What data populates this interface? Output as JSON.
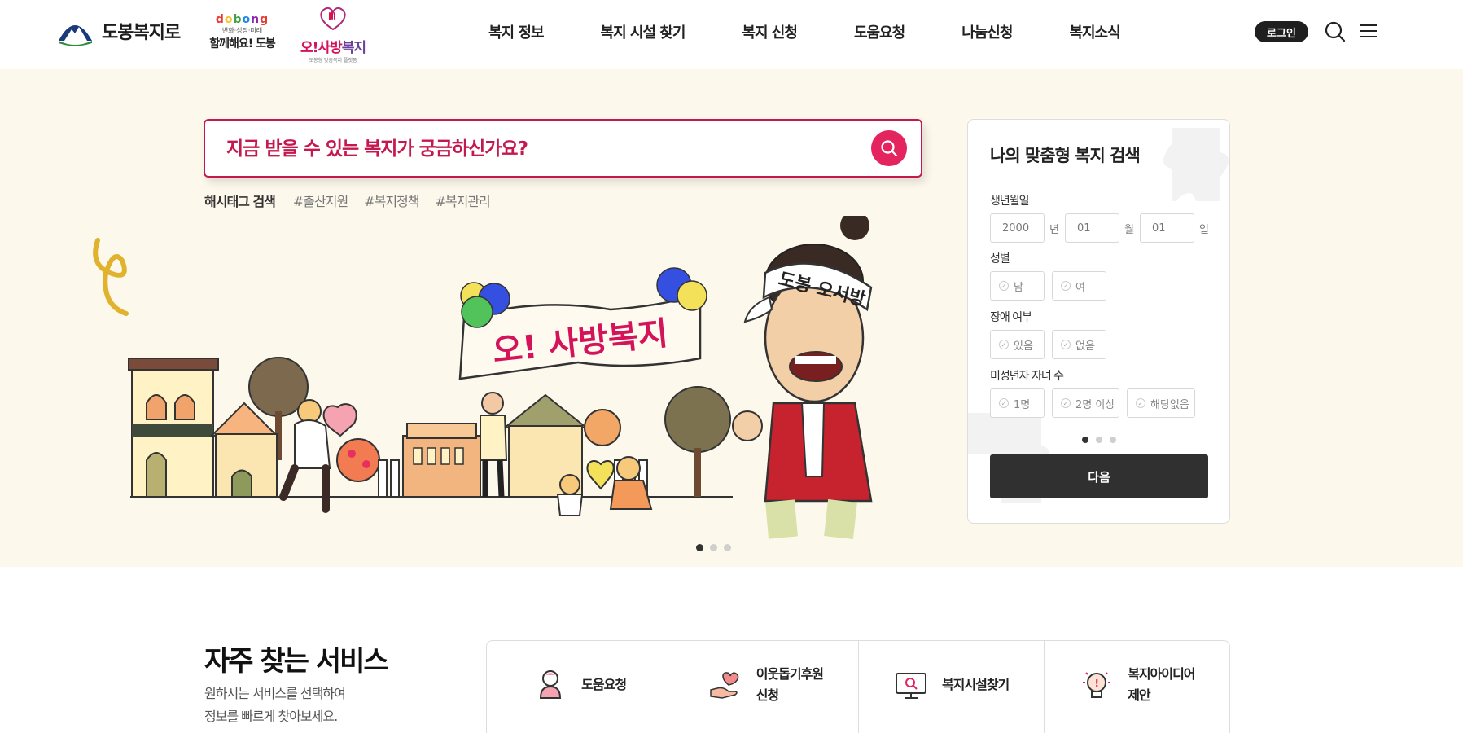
{
  "header": {
    "site_name": "도봉복지로",
    "sub_logo_1": {
      "top": "dobong",
      "middle": "변화·성장·미래",
      "bottom": "함께해요! 도봉"
    },
    "sub_logo_2": {
      "main": "오!사방",
      "accent": "복지",
      "small": "도봉형 맞춤복지 플랫폼"
    },
    "nav": [
      "복지 정보",
      "복지 시설 찾기",
      "복지 신청",
      "도움요청",
      "나눔신청",
      "복지소식"
    ],
    "login_label": "로그인",
    "icons": {
      "search": "search-icon",
      "menu": "hamburger-menu-icon"
    }
  },
  "hero": {
    "search_placeholder": "지금 받을 수 있는 복지가 궁금하신가요?",
    "hashtag_title": "해시태그 검색",
    "hashtags": [
      "#출산지원",
      "#복지정책",
      "#복지관리"
    ],
    "banner": {
      "sign_text": "오! 사방복지",
      "headband_text": "도봉 오서방"
    },
    "slide_count": 3,
    "active_slide": 1
  },
  "custom_search": {
    "title": "나의 맞춤형 복지 검색",
    "birth_label": "생년월일",
    "birth": {
      "year": "2000",
      "month": "01",
      "day": "01"
    },
    "units": {
      "year": "년",
      "month": "월",
      "day": "일"
    },
    "gender_label": "성별",
    "gender_options": [
      "남",
      "여"
    ],
    "disability_label": "장애 여부",
    "disability_options": [
      "있음",
      "없음"
    ],
    "children_label": "미성년자 자녀 수",
    "children_options": [
      "1명",
      "2명 이상",
      "해당없음"
    ],
    "step_count": 3,
    "active_step": 1,
    "next_label": "다음"
  },
  "frequent": {
    "title": "자주 찾는 서비스",
    "desc_line1": "원하시는 서비스를 선택하여",
    "desc_line2": "정보를 빠르게 찾아보세요.",
    "services": [
      {
        "label": "도움요청",
        "icon": "person-help-icon"
      },
      {
        "label": "이웃돕기후원\n신청",
        "icon": "heart-hand-icon"
      },
      {
        "label": "복지시설찾기",
        "icon": "monitor-search-icon"
      },
      {
        "label": "복지아이디어\n제안",
        "icon": "lightbulb-idea-icon"
      }
    ]
  },
  "colors": {
    "accent": "#c4194f",
    "hero_bg": "#fdf8ec",
    "dark": "#303030"
  }
}
